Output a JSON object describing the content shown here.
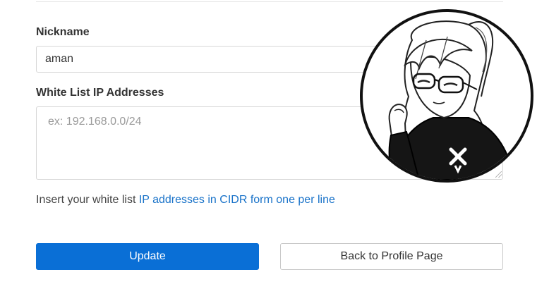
{
  "form": {
    "nickname_label": "Nickname",
    "nickname_value": "aman",
    "whitelist_label": "White List IP Addresses",
    "whitelist_placeholder": "ex: 192.168.0.0/24",
    "whitelist_value": "",
    "help_text": "Insert your white list ",
    "help_link": "IP addresses in CIDR form one per line"
  },
  "buttons": {
    "update_label": "Update",
    "back_label": "Back to Profile Page"
  },
  "avatar": {
    "icon": "anime-girl-avatar-icon",
    "logo_icon": "x-logo-icon"
  },
  "colors": {
    "primary": "#0a6fd6",
    "link": "#1a73c9",
    "border": "#d6d6d6"
  }
}
